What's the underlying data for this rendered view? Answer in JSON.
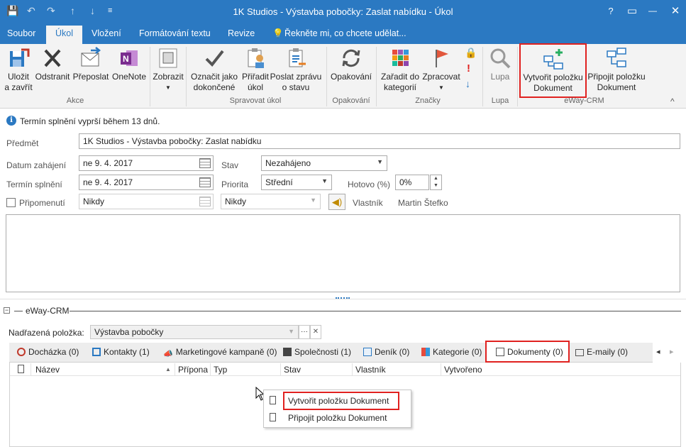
{
  "window": {
    "title": "1K Studios - Výstavba pobočky: Zaslat nabídku - Úkol",
    "help": "?",
    "restore": "▭",
    "minimize": "—",
    "maximize": "□",
    "close": "✕"
  },
  "qat": {
    "save": "💾",
    "undo": "↶",
    "redo": "↷",
    "up": "↑",
    "down": "↓",
    "more": "≡"
  },
  "ribbon_tabs": [
    {
      "label": "Soubor"
    },
    {
      "label": "Úkol"
    },
    {
      "label": "Vložení"
    },
    {
      "label": "Formátování textu"
    },
    {
      "label": "Revize"
    },
    {
      "label": "Řekněte mi, co chcete udělat..."
    }
  ],
  "ribbon": {
    "save_close": [
      "Uložit",
      "a zavřít"
    ],
    "delete": "Odstranit",
    "forward": "Přeposlat",
    "onenote": "OneNote",
    "group_akce": "Akce",
    "show": "Zobrazit",
    "mark_done": [
      "Označit jako",
      "dokončené"
    ],
    "assign": [
      "Přiřadit",
      "úkol"
    ],
    "send_status": [
      "Poslat zprávu",
      "o stavu"
    ],
    "group_manage": "Spravovat úkol",
    "recurrence": "Opakování",
    "group_recurrence": "Opakování",
    "categorize": [
      "Zařadit do",
      "kategorií"
    ],
    "followup": "Zpracovat",
    "group_tags": "Značky",
    "zoom": "Lupa",
    "group_zoom": "Lupa",
    "create_doc": [
      "Vytvořit položku",
      "Dokument"
    ],
    "attach_doc": [
      "Připojit položku",
      "Dokument"
    ],
    "group_eway": "eWay-CRM",
    "collapse": "^"
  },
  "info_bar": "Termín splnění vyprší během 13 dnů.",
  "form": {
    "subject_label": "Předmět",
    "subject_value": "1K Studios - Výstavba pobočky: Zaslat nabídku",
    "start_label": "Datum zahájení",
    "start_value": "ne 9. 4. 2017",
    "due_label": "Termín splnění",
    "due_value": "ne 9. 4. 2017",
    "status_label": "Stav",
    "status_value": "Nezahájeno",
    "priority_label": "Priorita",
    "priority_value": "Střední",
    "done_label": "Hotovo (%)",
    "done_value": "0%",
    "reminder_label": "Připomenutí",
    "reminder_date": "Nikdy",
    "reminder_time": "Nikdy",
    "owner_label": "Vlastník",
    "owner_value": "Martin Štefko"
  },
  "eway": {
    "header": "eWay-CRM",
    "parent_label": "Nadřazená položka:",
    "parent_value": "Výstavba pobočky",
    "more": "···",
    "clear": "✕",
    "tabs": [
      {
        "label": "Docházka (0)",
        "color": "#c0392b"
      },
      {
        "label": "Kontakty (1)",
        "color": "#2b79c2"
      },
      {
        "label": "Marketingové kampaně (0)",
        "color": "#555555"
      },
      {
        "label": "Společnosti (1)",
        "color": "#444444"
      },
      {
        "label": "Deník (0)",
        "color": "#2b79c2"
      },
      {
        "label": "Kategorie (0)",
        "color": "#e67e22"
      },
      {
        "label": "Dokumenty (0)",
        "color": "#555555"
      },
      {
        "label": "E-maily (0)",
        "color": "#555555"
      }
    ],
    "scroll_left": "◂",
    "scroll_right": "▸",
    "columns": [
      "Název",
      "Přípona",
      "Typ",
      "Stav",
      "Vlastník",
      "Vytvořeno"
    ],
    "sort_indicator": "▲",
    "context_menu": [
      "Vytvořit položku Dokument",
      "Připojit položku Dokument"
    ]
  },
  "colors": {
    "accent": "#2b79c2",
    "highlight": "#e0211f",
    "ribbon_bg": "#f3f3f3"
  }
}
